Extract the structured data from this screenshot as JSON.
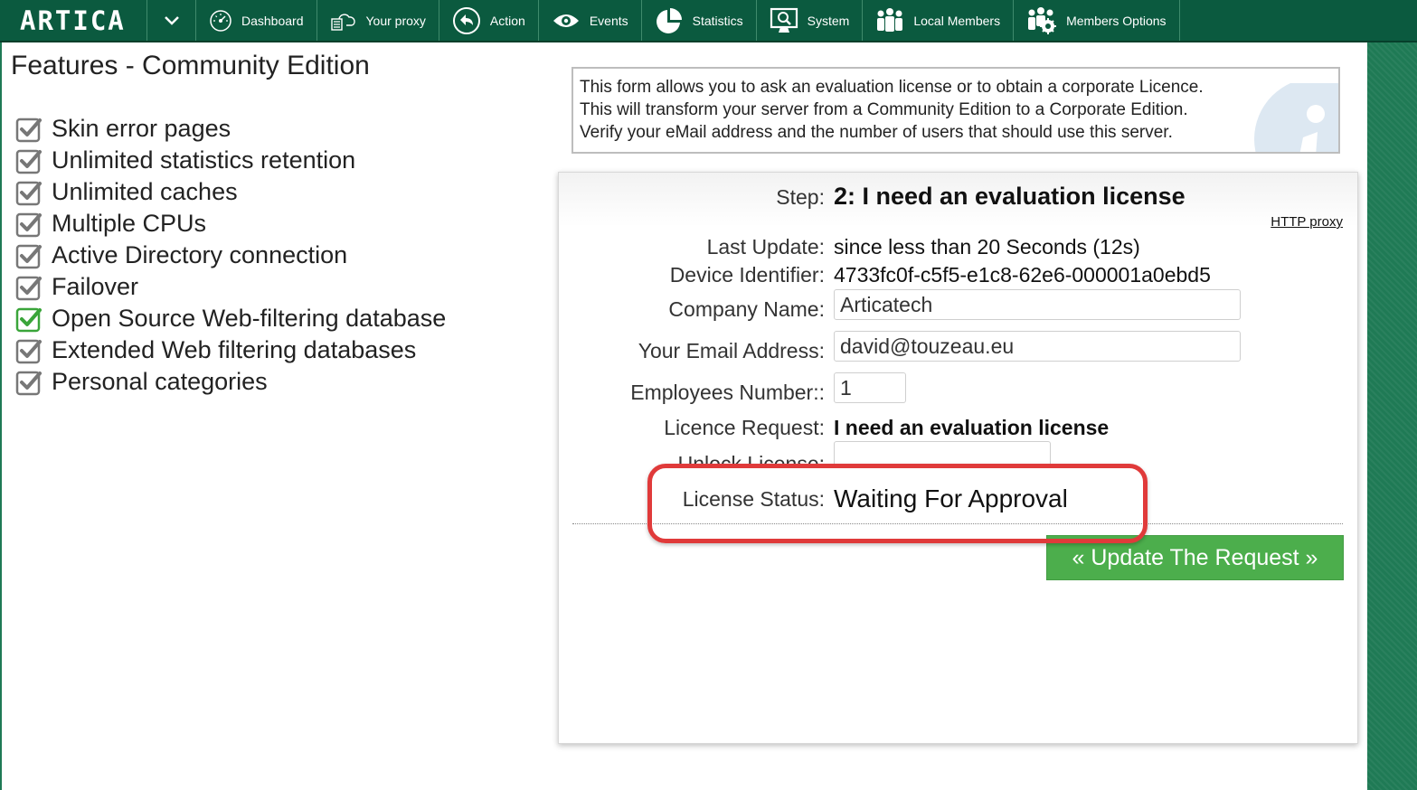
{
  "header": {
    "logo": "ARTICA",
    "nav": [
      {
        "label": "Dashboard",
        "icon": "dashboard-icon"
      },
      {
        "label": "Your proxy",
        "icon": "proxy-icon"
      },
      {
        "label": "Action",
        "icon": "action-icon"
      },
      {
        "label": "Events",
        "icon": "eye-icon"
      },
      {
        "label": "Statistics",
        "icon": "pie-chart-icon"
      },
      {
        "label": "System",
        "icon": "monitor-icon"
      },
      {
        "label": "Local Members",
        "icon": "users-icon"
      },
      {
        "label": "Members Options",
        "icon": "users-gear-icon"
      }
    ]
  },
  "features": {
    "title": "Features - Community Edition",
    "items": [
      {
        "label": "Skin error pages",
        "checked": true,
        "color": "#777777"
      },
      {
        "label": "Unlimited statistics retention",
        "checked": true,
        "color": "#777777"
      },
      {
        "label": "Unlimited caches",
        "checked": true,
        "color": "#777777"
      },
      {
        "label": "Multiple CPUs",
        "checked": true,
        "color": "#777777"
      },
      {
        "label": "Active Directory connection",
        "checked": true,
        "color": "#777777"
      },
      {
        "label": "Failover",
        "checked": true,
        "color": "#777777"
      },
      {
        "label": "Open Source Web-filtering database",
        "checked": true,
        "color": "#3aa53a"
      },
      {
        "label": "Extended Web filtering databases",
        "checked": true,
        "color": "#777777"
      },
      {
        "label": "Personal categories",
        "checked": true,
        "color": "#777777"
      }
    ]
  },
  "info": {
    "lines": [
      "This form allows you to ask an evaluation license or to obtain a corporate Licence.",
      "This will transform your server from a Community Edition to a Corporate Edition.",
      "Verify your eMail address and the number of users that should use this server."
    ],
    "icon": "info-icon"
  },
  "form": {
    "step_label": "Step:",
    "step_value": "2: I need an evaluation license",
    "http_proxy_link": "HTTP proxy",
    "last_update_label": "Last Update:",
    "last_update_value": "since less than 20 Seconds (12s)",
    "device_id_label": "Device Identifier:",
    "device_id_value": "4733fc0f-c5f5-e1c8-62e6-000001a0ebd5",
    "company_label": "Company Name:",
    "company_value": "Articatech",
    "email_label": "Your Email Address:",
    "email_value": "david@touzeau.eu",
    "employees_label": "Employees Number::",
    "employees_value": "1",
    "licence_request_label": "Licence Request:",
    "licence_request_value": "I need an evaluation license",
    "unlock_label": "Unlock License:",
    "unlock_value": "",
    "status_label": "License Status:",
    "status_value": "Waiting For Approval",
    "update_button": "« Update The Request »"
  },
  "colors": {
    "header_bg": "#0b5a3f",
    "accent_green": "#4cae4c",
    "highlight_red": "#e03a3a"
  }
}
